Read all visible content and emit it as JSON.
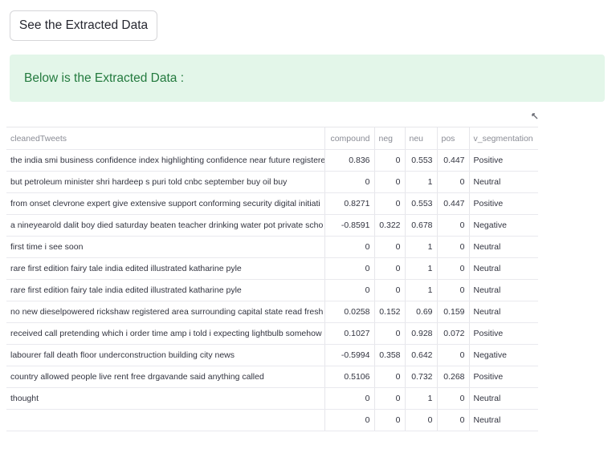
{
  "button": {
    "label": "See the Extracted Data"
  },
  "success": {
    "message": "Below is the Extracted Data :"
  },
  "table": {
    "columns": [
      "cleanedTweets",
      "compound",
      "neg",
      "neu",
      "pos",
      "v_segmentation"
    ],
    "rows": [
      [
        "the india smi business confidence index highlighting confidence near future registere",
        "0.836",
        "0",
        "0.553",
        "0.447",
        "Positive"
      ],
      [
        "but petroleum minister shri hardeep s puri told cnbc september buy oil buy",
        "0",
        "0",
        "1",
        "0",
        "Neutral"
      ],
      [
        "from onset clevrone expert give extensive support conforming security digital initiati",
        "0.8271",
        "0",
        "0.553",
        "0.447",
        "Positive"
      ],
      [
        "a nineyearold dalit boy died saturday beaten teacher drinking water pot private scho",
        "-0.8591",
        "0.322",
        "0.678",
        "0",
        "Negative"
      ],
      [
        "first time i see soon",
        "0",
        "0",
        "1",
        "0",
        "Neutral"
      ],
      [
        "rare first edition fairy tale india edited illustrated katharine pyle",
        "0",
        "0",
        "1",
        "0",
        "Neutral"
      ],
      [
        "rare first edition fairy tale india edited illustrated katharine pyle",
        "0",
        "0",
        "1",
        "0",
        "Neutral"
      ],
      [
        "no new dieselpowered rickshaw registered area surrounding capital state read fresh a",
        "0.0258",
        "0.152",
        "0.69",
        "0.159",
        "Neutral"
      ],
      [
        "received call pretending which i order time amp i told i expecting lightbulb somehow",
        "0.1027",
        "0",
        "0.928",
        "0.072",
        "Positive"
      ],
      [
        "labourer fall death floor underconstruction building city news",
        "-0.5994",
        "0.358",
        "0.642",
        "0",
        "Negative"
      ],
      [
        "country allowed people live rent free drgavande said anything called",
        "0.5106",
        "0",
        "0.732",
        "0.268",
        "Positive"
      ],
      [
        "thought",
        "0",
        "0",
        "1",
        "0",
        "Neutral"
      ],
      [
        "",
        "0",
        "0",
        "0",
        "0",
        "Neutral"
      ]
    ]
  },
  "icons": {
    "fullscreen": "expand-icon"
  },
  "colors": {
    "success_bg": "#e3f6e9",
    "success_text": "#237a3e",
    "header_text": "#8a8c95"
  }
}
